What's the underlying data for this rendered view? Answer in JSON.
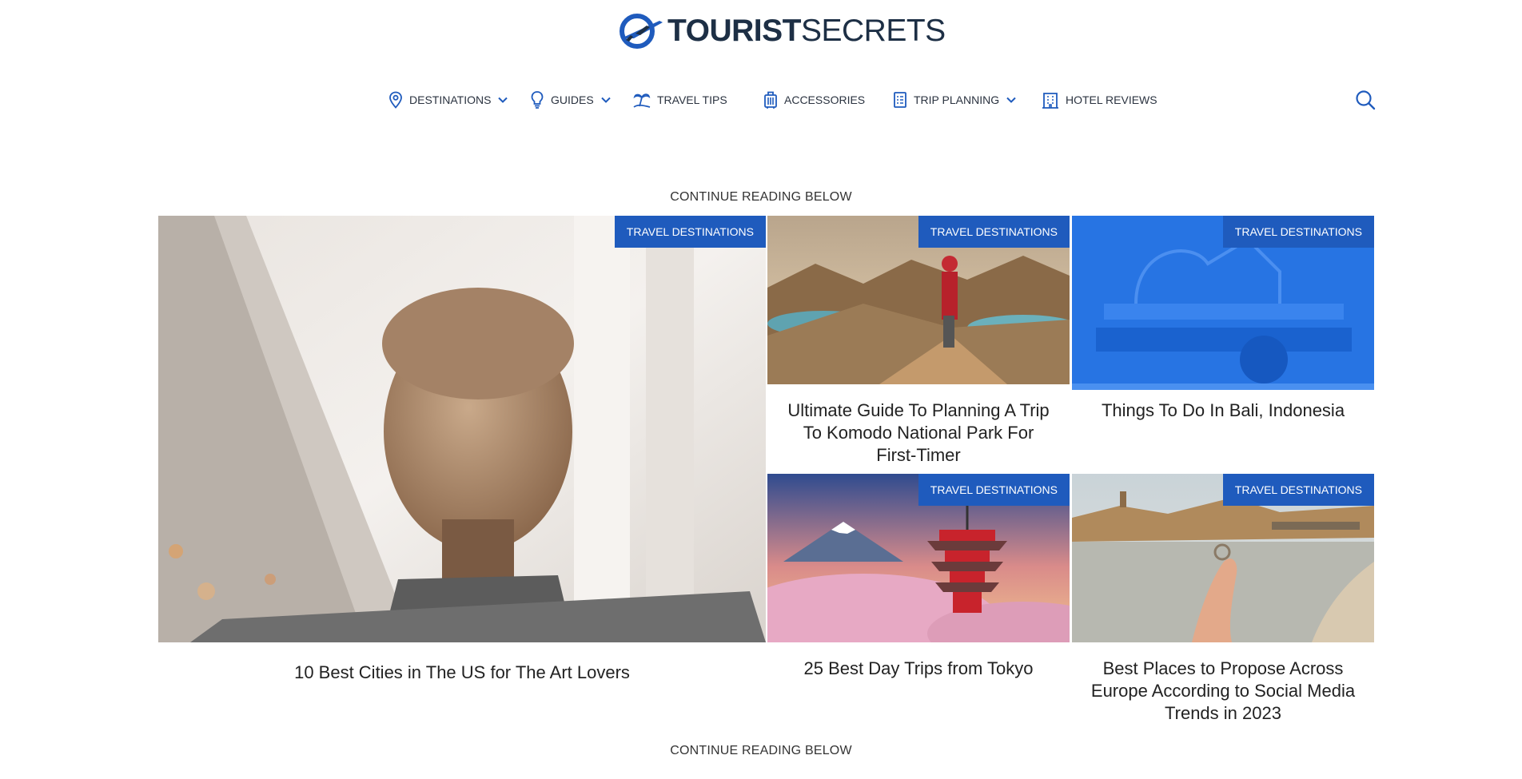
{
  "site": {
    "logo_bold": "TOURIST",
    "logo_light": "SECRETS"
  },
  "nav": {
    "items": [
      {
        "label": "DESTINATIONS",
        "icon": "map-pin-icon",
        "has_dropdown": true
      },
      {
        "label": "GUIDES",
        "icon": "lightbulb-icon",
        "has_dropdown": true
      },
      {
        "label": "TRAVEL TIPS",
        "icon": "beach-palm-icon",
        "has_dropdown": false
      },
      {
        "label": "ACCESSORIES",
        "icon": "luggage-icon",
        "has_dropdown": false
      },
      {
        "label": "TRIP PLANNING",
        "icon": "checklist-icon",
        "has_dropdown": true
      },
      {
        "label": "HOTEL REVIEWS",
        "icon": "hotel-building-icon",
        "has_dropdown": false
      }
    ],
    "search_icon": "search-icon"
  },
  "content": {
    "continue_top": "CONTINUE READING BELOW",
    "continue_bottom": "CONTINUE READING BELOW",
    "cards": [
      {
        "category": "TRAVEL DESTINATIONS",
        "title": "10 Best Cities in The US for The Art Lovers",
        "image": "marble bust statue in museum"
      },
      {
        "category": "TRAVEL DESTINATIONS",
        "title": "Ultimate Guide To Planning A Trip To Komodo National Park For First-Timer",
        "image": "traveler in red hijab on Padar Island hilltop"
      },
      {
        "category": "TRAVEL DESTINATIONS",
        "title": "Things To Do In Bali, Indonesia",
        "image": "blue-tinted Bali temple"
      },
      {
        "category": "TRAVEL DESTINATIONS",
        "title": "25 Best Day Trips from Tokyo",
        "image": "Chureito pagoda with Mount Fuji and cherry blossoms"
      },
      {
        "category": "TRAVEL DESTINATIONS",
        "title": "Best Places to Propose Across Europe According to Social Media Trends in 2023",
        "image": "hand holding ring by river in Prague"
      }
    ]
  },
  "colors": {
    "brand_blue": "#1f5bbd",
    "logo_dark": "#1d2f45",
    "nav_icon_blue": "#1f5bbd"
  }
}
